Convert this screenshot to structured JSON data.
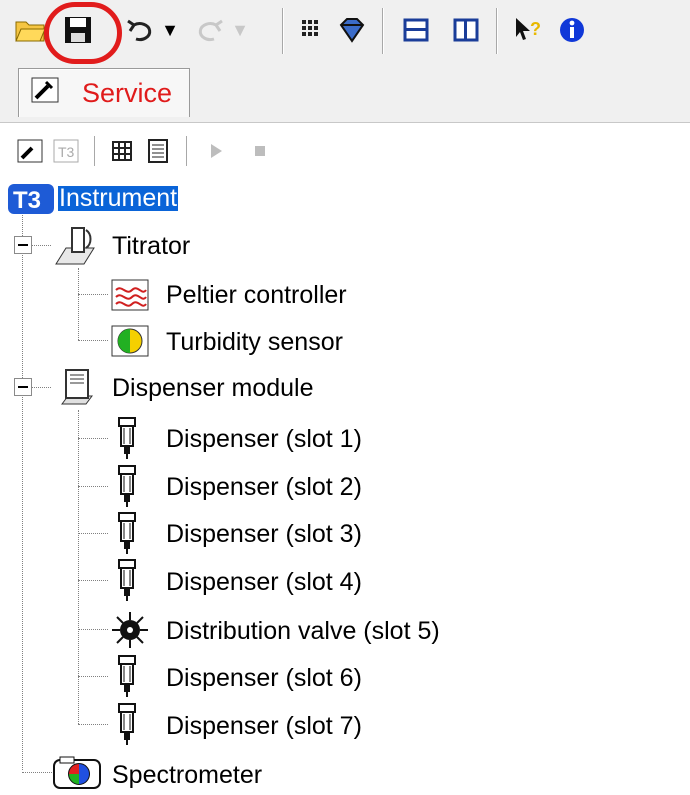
{
  "toolbar": {
    "buttons": [
      {
        "icon": "open-folder-icon"
      },
      {
        "icon": "save-icon"
      },
      {
        "icon": "undo-icon"
      },
      {
        "icon": "redo-icon"
      },
      {
        "icon": "grid-icon"
      },
      {
        "icon": "gem-icon"
      },
      {
        "icon": "split-horizontal-icon"
      },
      {
        "icon": "split-vertical-icon"
      },
      {
        "icon": "whats-this-help-icon"
      },
      {
        "icon": "info-icon"
      }
    ]
  },
  "tabs": [
    {
      "label": "Service",
      "active": true,
      "icon": "service-icon"
    }
  ],
  "tree": {
    "root": {
      "label": "Instrument",
      "selected": true,
      "icon": "t3-logo-icon"
    },
    "nodes": [
      {
        "label": "Titrator",
        "icon": "titrator-icon",
        "expanded": true,
        "children": [
          {
            "label": "Peltier controller",
            "icon": "peltier-icon"
          },
          {
            "label": "Turbidity sensor",
            "icon": "turbidity-icon"
          }
        ]
      },
      {
        "label": "Dispenser module",
        "icon": "dispenser-module-icon",
        "expanded": true,
        "children": [
          {
            "label": "Dispenser (slot 1)",
            "icon": "dispenser-icon"
          },
          {
            "label": "Dispenser (slot 2)",
            "icon": "dispenser-icon"
          },
          {
            "label": "Dispenser (slot 3)",
            "icon": "dispenser-icon"
          },
          {
            "label": "Dispenser (slot 4)",
            "icon": "dispenser-icon"
          },
          {
            "label": "Distribution valve (slot 5)",
            "icon": "valve-icon"
          },
          {
            "label": "Dispenser (slot 6)",
            "icon": "dispenser-icon"
          },
          {
            "label": "Dispenser (slot 7)",
            "icon": "dispenser-icon"
          }
        ]
      },
      {
        "label": "Spectrometer",
        "icon": "spectrometer-icon"
      }
    ]
  },
  "colors": {
    "selection": "#0a64d8",
    "tab_text": "#e01b1b",
    "highlight": "#e11c1c"
  }
}
